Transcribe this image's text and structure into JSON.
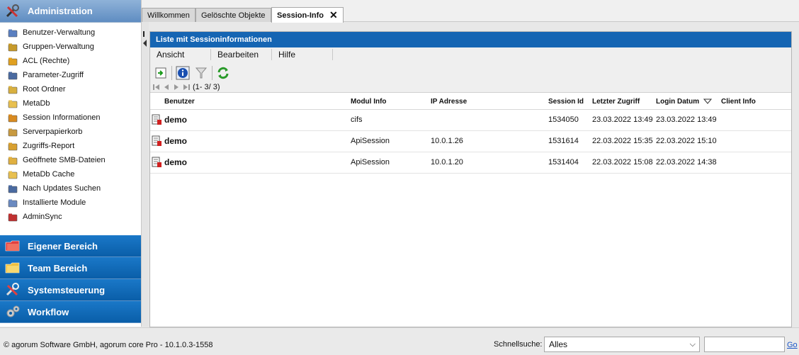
{
  "sidebar": {
    "active_section": {
      "label": "Administration",
      "icon": "tools-icon"
    },
    "admin_items": [
      {
        "label": "Benutzer-Verwaltung",
        "icon": "user-icon"
      },
      {
        "label": "Gruppen-Verwaltung",
        "icon": "group-icon"
      },
      {
        "label": "ACL (Rechte)",
        "icon": "acl-icon"
      },
      {
        "label": "Parameter-Zugriff",
        "icon": "parameter-icon"
      },
      {
        "label": "Root Ordner",
        "icon": "root-folder-icon"
      },
      {
        "label": "MetaDb",
        "icon": "metadb-icon"
      },
      {
        "label": "Session Informationen",
        "icon": "session-icon"
      },
      {
        "label": "Serverpapierkorb",
        "icon": "trash-icon"
      },
      {
        "label": "Zugriffs-Report",
        "icon": "report-icon"
      },
      {
        "label": "Geöffnete SMB-Dateien",
        "icon": "smb-icon"
      },
      {
        "label": "MetaDb Cache",
        "icon": "cache-icon"
      },
      {
        "label": "Nach Updates Suchen",
        "icon": "update-icon"
      },
      {
        "label": "Installierte Module",
        "icon": "module-icon"
      },
      {
        "label": "AdminSync",
        "icon": "sync-icon"
      }
    ],
    "sections": [
      {
        "label": "Eigener Bereich",
        "icon": "personal-folder-icon"
      },
      {
        "label": "Team Bereich",
        "icon": "team-folder-icon"
      },
      {
        "label": "Systemsteuerung",
        "icon": "system-tools-icon"
      },
      {
        "label": "Workflow",
        "icon": "workflow-icon"
      }
    ]
  },
  "tabs": [
    {
      "label": "Willkommen"
    },
    {
      "label": "Gelöschte Objekte"
    },
    {
      "label": "Session-Info",
      "close": "✕"
    }
  ],
  "panel": {
    "title": "Liste mit Sessioninformationen",
    "menu": [
      "Ansicht",
      "Bearbeiten",
      "Hilfe"
    ],
    "pager_text": "(1- 3/ 3)"
  },
  "grid": {
    "columns": [
      "Benutzer",
      "Modul Info",
      "IP Adresse",
      "Session Id",
      "Letzter Zugriff",
      "Login Datum",
      "Client Info"
    ],
    "rows": [
      {
        "user": "demo",
        "module": "cifs",
        "ip": "",
        "session": "1534050",
        "last": "23.03.2022 13:49",
        "login": "23.03.2022 13:49",
        "client": ""
      },
      {
        "user": "demo",
        "module": "ApiSession",
        "ip": "10.0.1.26",
        "session": "1531614",
        "last": "22.03.2022 15:35",
        "login": "22.03.2022 15:10",
        "client": ""
      },
      {
        "user": "demo",
        "module": "ApiSession",
        "ip": "10.0.1.20",
        "session": "1531404",
        "last": "22.03.2022 15:08",
        "login": "22.03.2022 14:38",
        "client": ""
      }
    ]
  },
  "footer": {
    "copyright": "© agorum Software GmbH, agorum core Pro - 10.1.0.3-1558",
    "quick_search_label": "Schnellsuche:",
    "quick_search_value": "Alles",
    "go": "Go"
  },
  "colors": {
    "accent": "#1565b3",
    "section_header": "#0a5ea8",
    "active_header": "#7aa3d0"
  }
}
